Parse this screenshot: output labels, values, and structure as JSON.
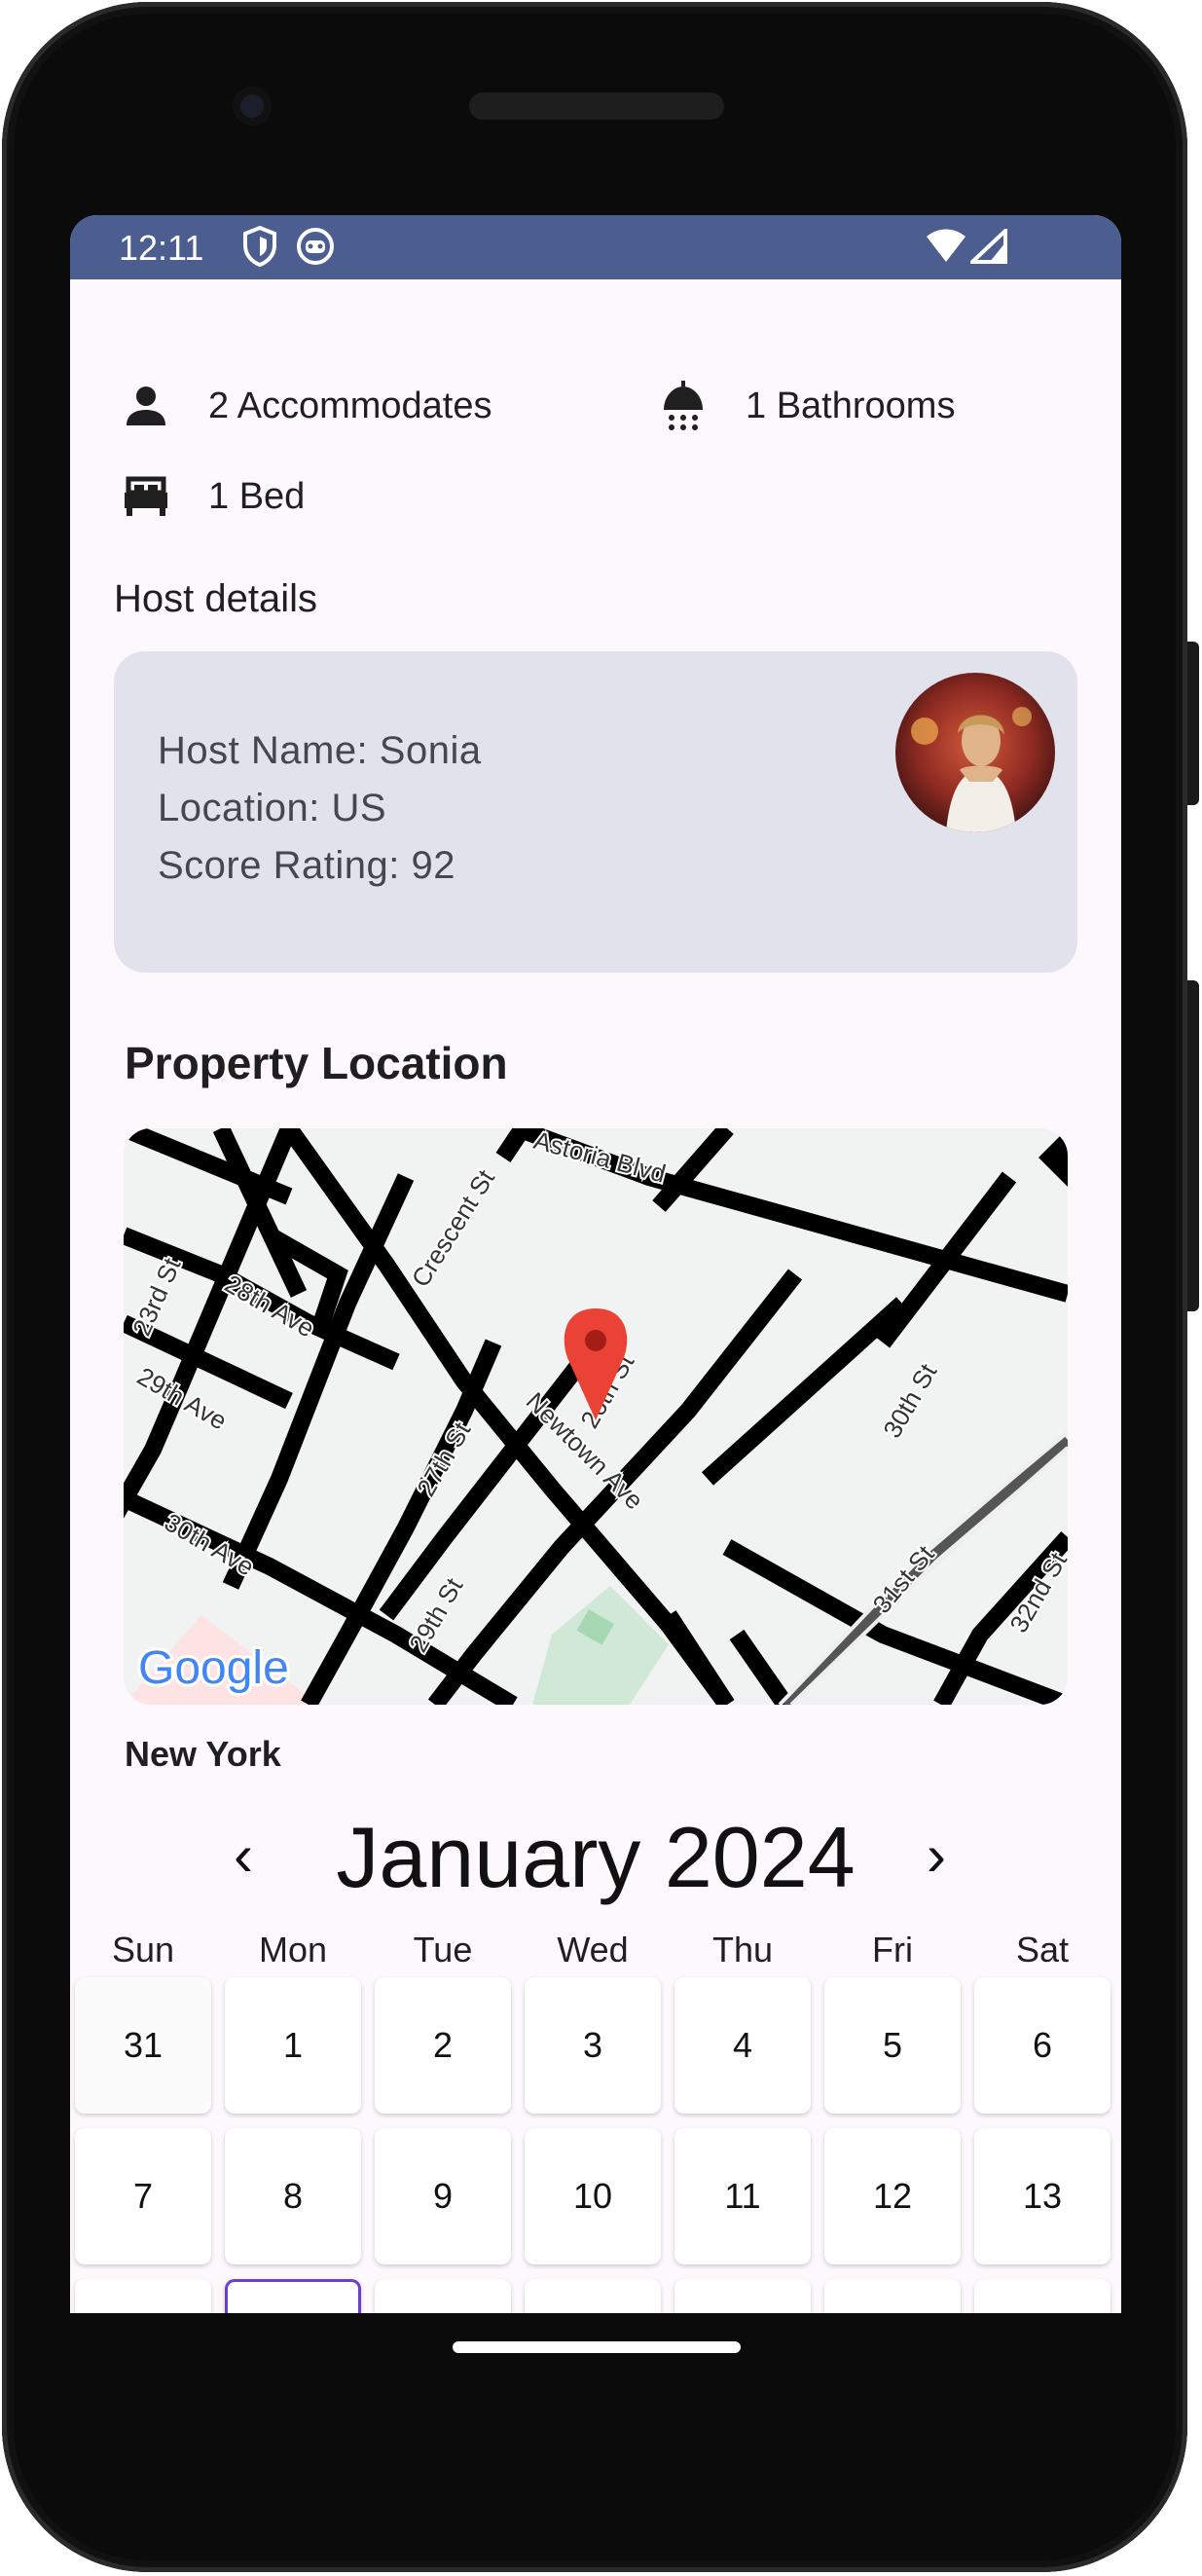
{
  "status_bar": {
    "time": "12:11"
  },
  "amenities": {
    "accommodates": "2 Accommodates",
    "bathrooms": "1 Bathrooms",
    "bed": "1 Bed"
  },
  "host": {
    "section_title": "Host details",
    "name": "Host Name: Sonia",
    "location": "Location: US",
    "score": "Score Rating: 92"
  },
  "property_location": {
    "title": "Property Location",
    "city": "New York",
    "map_labels": [
      "Astoria Blvd",
      "Crescent St",
      "23rd St",
      "28th Ave",
      "29th Ave",
      "30th Ave",
      "27th St",
      "Newtown Ave",
      "26th St",
      "29th St",
      "30th St",
      "31st St",
      "32nd St"
    ],
    "map_logo": "Google"
  },
  "calendar": {
    "month_label": "January 2024",
    "prev_label": "‹",
    "next_label": "›",
    "weekdays": [
      "Sun",
      "Mon",
      "Tue",
      "Wed",
      "Thu",
      "Fri",
      "Sat"
    ],
    "week1": [
      "31",
      "1",
      "2",
      "3",
      "4",
      "5",
      "6"
    ],
    "week2": [
      "7",
      "8",
      "9",
      "10",
      "11",
      "12",
      "13"
    ]
  },
  "colors": {
    "status_bar": "#4b5e8f",
    "host_card": "#e1e2ec",
    "selected_outline": "#6a3fd0"
  }
}
